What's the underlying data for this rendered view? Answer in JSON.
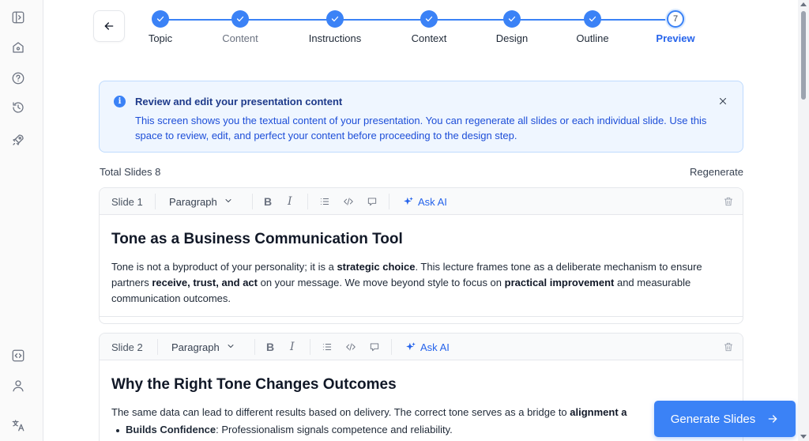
{
  "stepper": {
    "steps": [
      {
        "label": "Topic",
        "state": "done"
      },
      {
        "label": "Content",
        "state": "done-muted"
      },
      {
        "label": "Instructions",
        "state": "done"
      },
      {
        "label": "Context",
        "state": "done"
      },
      {
        "label": "Design",
        "state": "done"
      },
      {
        "label": "Outline",
        "state": "done"
      },
      {
        "label": "Preview",
        "state": "current",
        "number": "7"
      }
    ]
  },
  "banner": {
    "title": "Review and edit your presentation content",
    "body": "This screen shows you the textual content of your presentation. You can regenerate all slides or each individual slide. Use this space to review, edit, and perfect your content before proceeding to the design step.",
    "info_glyph": "i"
  },
  "summary": {
    "total_label": "Total Slides",
    "total_count": "8",
    "regenerate_label": "Regenerate"
  },
  "toolbar": {
    "paragraph_label": "Paragraph",
    "bold_glyph": "B",
    "italic_glyph": "I",
    "ask_ai_label": "Ask AI"
  },
  "slides": [
    {
      "label": "Slide 1",
      "title": "Tone as a Business Communication Tool",
      "text_segments": [
        {
          "t": "Tone is not a byproduct of your personality; it is a "
        },
        {
          "t": "strategic choice",
          "b": true
        },
        {
          "t": ". This lecture frames tone as a deliberate mechanism to ensure partners "
        },
        {
          "t": "receive, trust, and act",
          "b": true
        },
        {
          "t": " on your message. We move beyond style to focus on "
        },
        {
          "t": "practical improvement",
          "b": true
        },
        {
          "t": " and measurable communication outcomes."
        }
      ]
    },
    {
      "label": "Slide 2",
      "title": "Why the Right Tone Changes Outcomes",
      "text_segments": [
        {
          "t": "The same data can lead to different results based on delivery. The correct tone serves as a bridge to "
        },
        {
          "t": "alignment a",
          "b": true
        }
      ],
      "bullet_segments": [
        {
          "t": "Builds Confidence",
          "b": true
        },
        {
          "t": ": Professionalism signals competence and reliability."
        }
      ]
    }
  ],
  "generate_button": {
    "label": "Generate Slides"
  },
  "colors": {
    "accent": "#3b82f6",
    "accent_dark": "#2563eb",
    "banner_bg": "#eff6ff"
  }
}
